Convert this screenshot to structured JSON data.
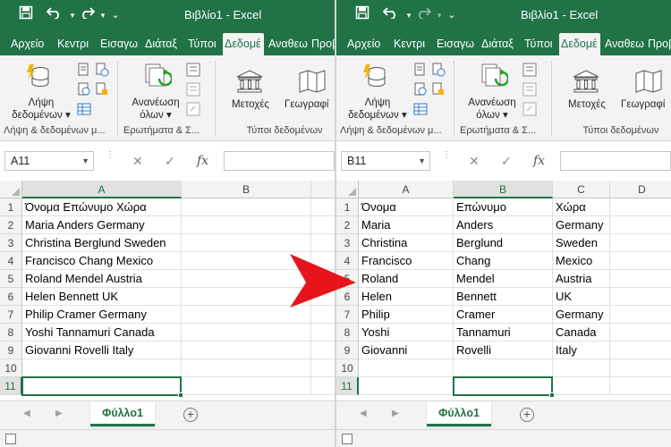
{
  "colors": {
    "brand": "#217346",
    "ribbon": "#f3f3f3",
    "arrow": "#e8141b"
  },
  "left": {
    "title": "Βιβλίο1 - Excel",
    "tabs": [
      "Αρχείο",
      "Κεντρι",
      "Εισαγω",
      "Διάταξ",
      "Τύποι",
      "Δεδομέ",
      "Αναθεω",
      "Προβ"
    ],
    "active_tab_index": 5,
    "ribbon": {
      "get_data_label": "Λήψη",
      "get_data_label2": "δεδομένων ▾",
      "refresh_label": "Ανανέωση",
      "refresh_label2": "όλων ▾",
      "stocks_label": "Μετοχές",
      "geo_label": "Γεωγραφί",
      "group_get": "Λήψη & δεδομένων μ...",
      "group_queries": "Ερωτήματα & Σ...",
      "group_types": "Τύποι δεδομένων"
    },
    "name_box": "A11",
    "fx_label": "fx",
    "columns": [
      "A",
      "B"
    ],
    "rows": [
      "1",
      "2",
      "3",
      "4",
      "5",
      "6",
      "7",
      "8",
      "9",
      "10",
      "11"
    ],
    "cells_a": [
      "Όνομα Επώνυμο Χώρα",
      "Maria Anders Germany",
      "Christina Berglund Sweden",
      "Francisco Chang Mexico",
      "Roland Mendel Austria",
      "Helen Bennett UK",
      "Philip Cramer Germany",
      "Yoshi Tannamuri Canada",
      "Giovanni Rovelli Italy",
      "",
      ""
    ],
    "sheet_tab": "Φύλλο1",
    "add_sheet": "+"
  },
  "right": {
    "title": "Βιβλίο1 - Excel",
    "tabs": [
      "Αρχείο",
      "Κεντρι",
      "Εισαγω",
      "Διάταξ",
      "Τύποι",
      "Δεδομέ",
      "Αναθεω",
      "Προβ"
    ],
    "active_tab_index": 5,
    "ribbon": {
      "get_data_label": "Λήψη",
      "get_data_label2": "δεδομένων ▾",
      "refresh_label": "Ανανέωση",
      "refresh_label2": "όλων ▾",
      "stocks_label": "Μετοχές",
      "geo_label": "Γεωγραφί",
      "group_get": "Λήψη & δεδομένων μ...",
      "group_queries": "Ερωτήματα & Σ...",
      "group_types": "Τύποι δεδομένων"
    },
    "name_box": "B11",
    "fx_label": "fx",
    "columns": [
      "A",
      "B",
      "C",
      "D"
    ],
    "rows": [
      "1",
      "2",
      "3",
      "4",
      "5",
      "6",
      "7",
      "8",
      "9",
      "10",
      "11"
    ],
    "cells_a": [
      "Όνομα",
      "Maria",
      "Christina",
      "Francisco",
      "Roland",
      "Helen",
      "Philip",
      "Yoshi",
      "Giovanni",
      "",
      ""
    ],
    "cells_b": [
      "Επώνυμο",
      "Anders",
      "Berglund",
      "Chang",
      "Mendel",
      "Bennett",
      "Cramer",
      "Tannamuri",
      "Rovelli",
      "",
      ""
    ],
    "cells_c": [
      "Χώρα",
      "Germany",
      "Sweden",
      "Mexico",
      "Austria",
      "UK",
      "Germany",
      "Canada",
      "Italy",
      "",
      ""
    ],
    "sheet_tab": "Φύλλο1",
    "add_sheet": "+"
  }
}
